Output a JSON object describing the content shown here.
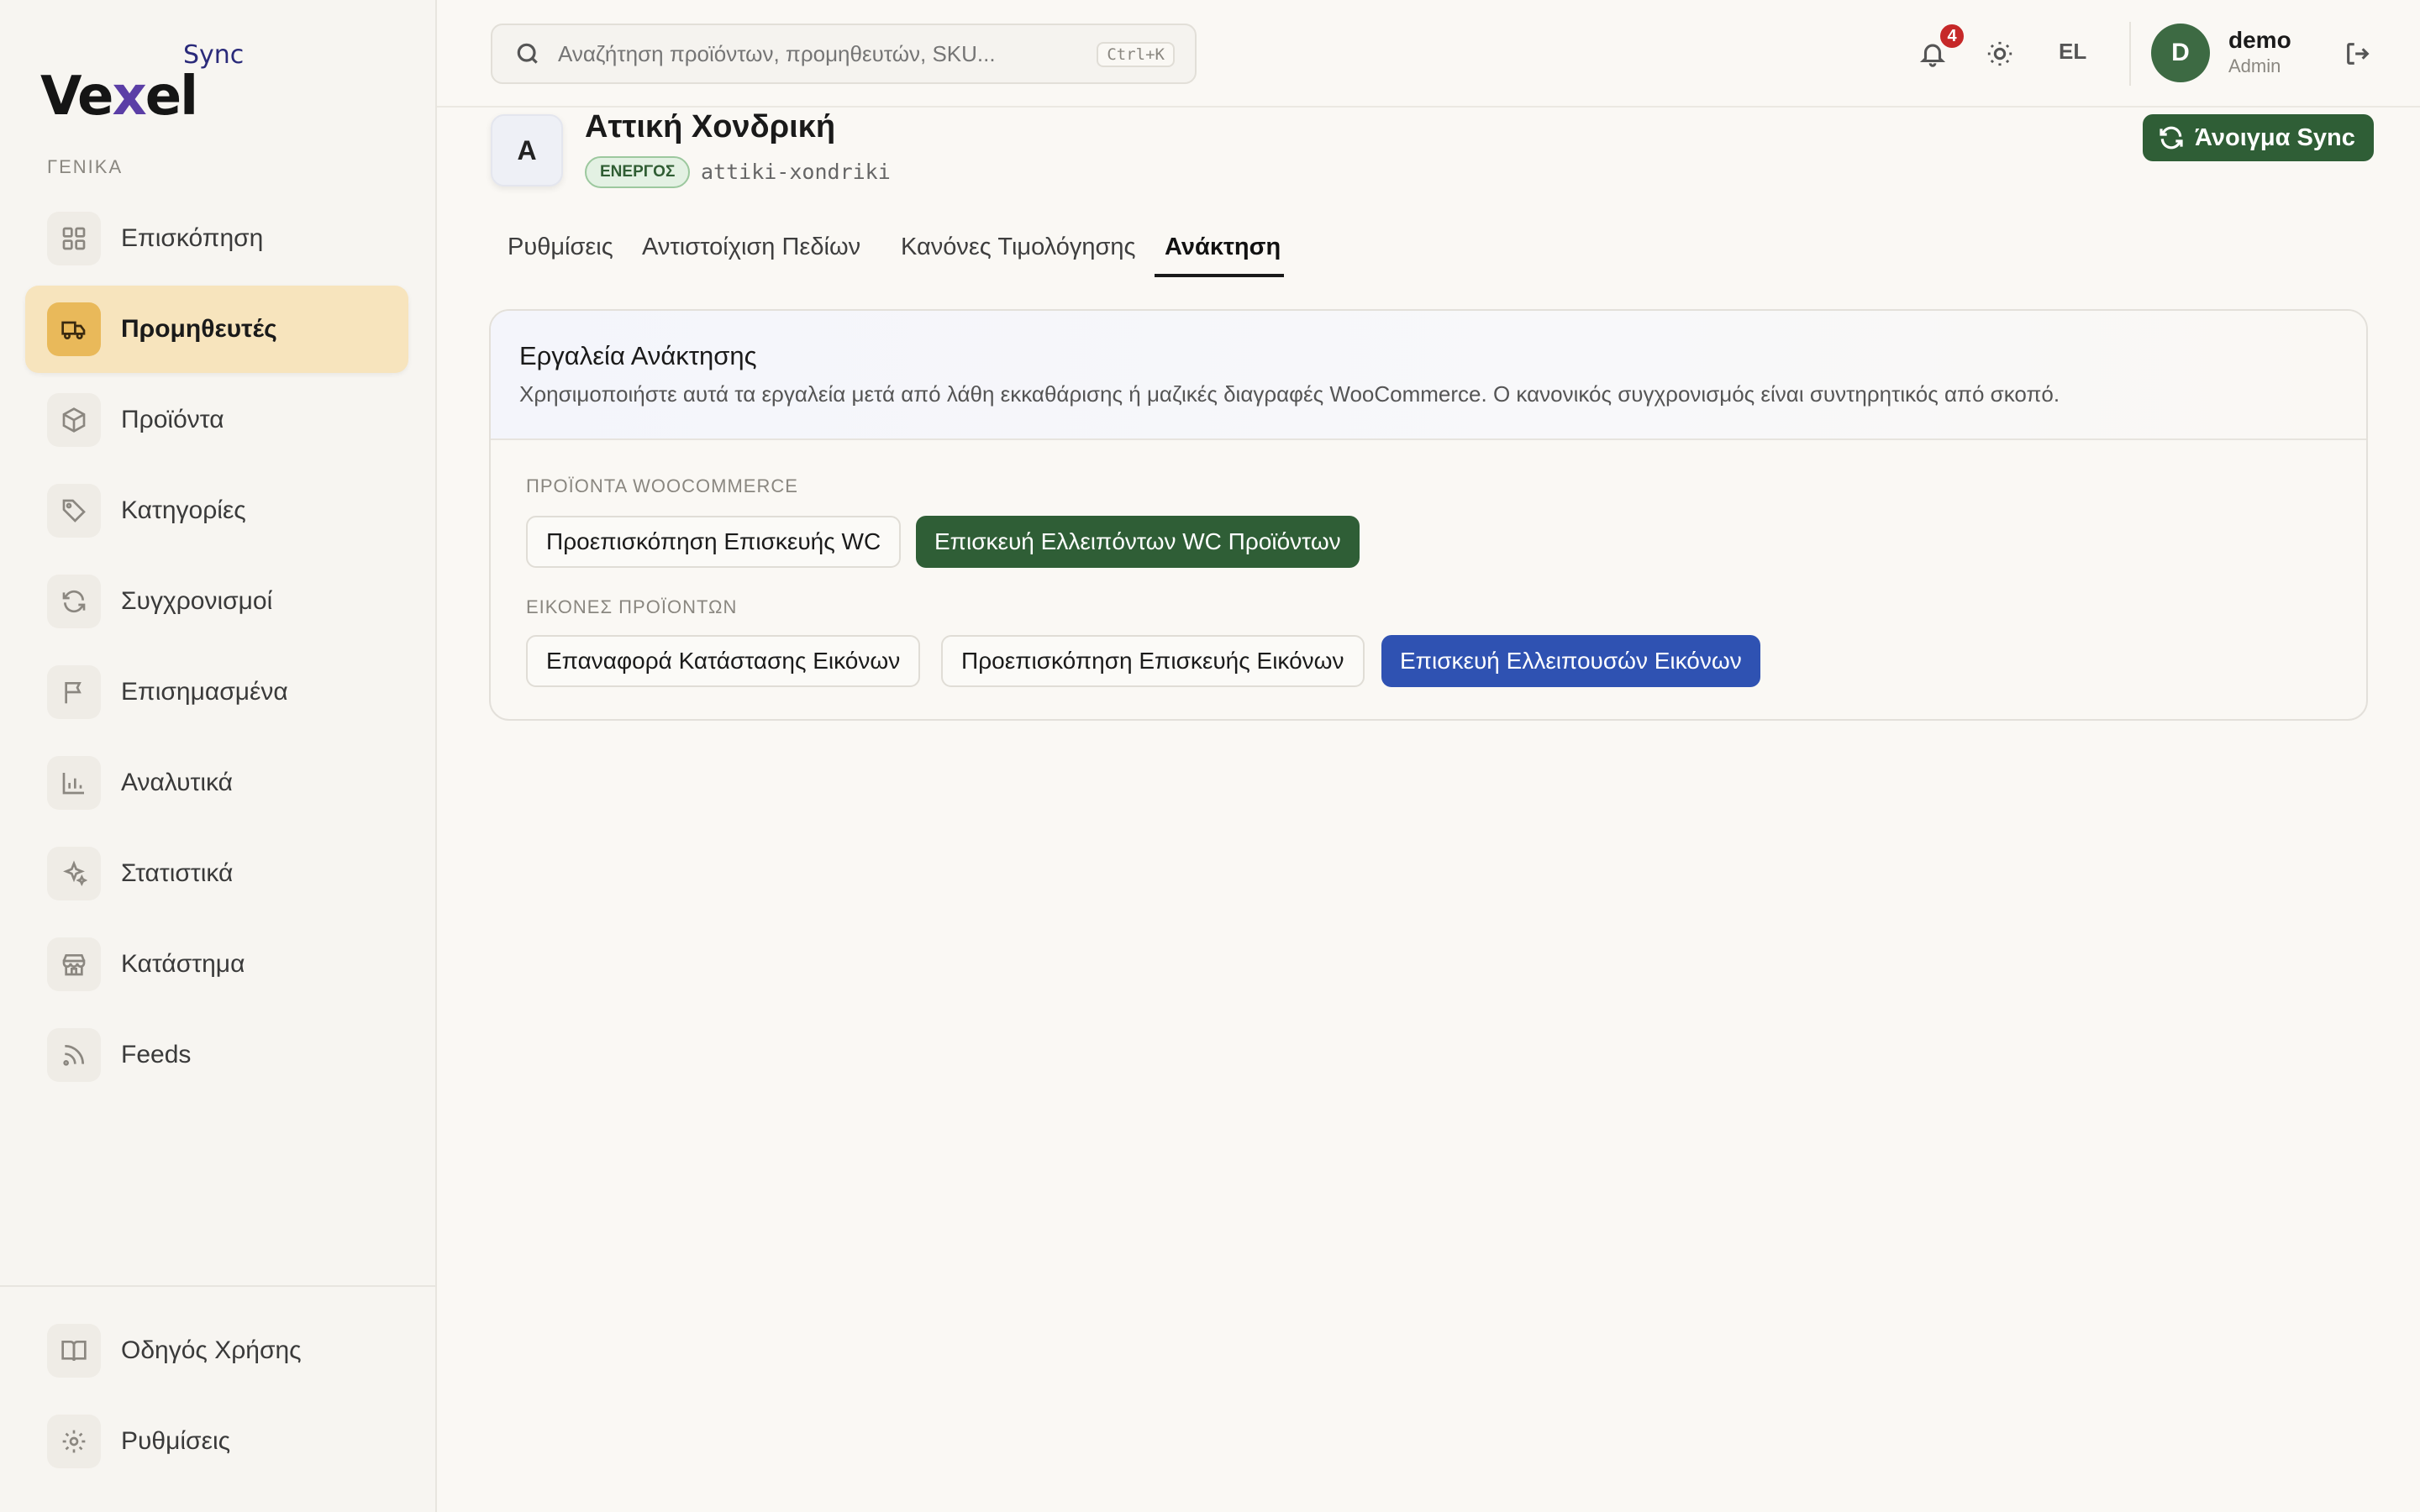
{
  "brand": {
    "name_prefix": "Ve",
    "name_x": "x",
    "name_suffix": "el",
    "sub": "Sync"
  },
  "sidebar": {
    "section_label": "ΓΕΝΙΚΑ",
    "items": [
      {
        "label": "Επισκόπηση",
        "icon": "grid-icon"
      },
      {
        "label": "Προμηθευτές",
        "icon": "truck-icon",
        "active": true
      },
      {
        "label": "Προϊόντα",
        "icon": "box-icon"
      },
      {
        "label": "Κατηγορίες",
        "icon": "tag-icon"
      },
      {
        "label": "Συγχρονισμοί",
        "icon": "refresh-icon"
      },
      {
        "label": "Επισημασμένα",
        "icon": "flag-icon"
      },
      {
        "label": "Αναλυτικά",
        "icon": "bar-chart-icon"
      },
      {
        "label": "Στατιστικά",
        "icon": "sparkles-icon"
      },
      {
        "label": "Κατάστημα",
        "icon": "store-icon"
      },
      {
        "label": "Feeds",
        "icon": "rss-icon"
      }
    ],
    "bottom_items": [
      {
        "label": "Οδηγός Χρήσης",
        "icon": "book-icon"
      },
      {
        "label": "Ρυθμίσεις",
        "icon": "gear-icon"
      }
    ]
  },
  "header": {
    "search_placeholder": "Αναζήτηση προϊόντων, προμηθευτών, SKU...",
    "search_shortcut": "Ctrl+K",
    "notifications_count": "4",
    "language": "EL",
    "user": {
      "initial": "D",
      "name": "demo",
      "role": "Admin"
    }
  },
  "supplier": {
    "initial": "A",
    "name": "Αττική Χονδρική",
    "status": "ΕΝΕΡΓΟΣ",
    "slug": "attiki-xondriki",
    "open_sync_label": "Άνοιγμα Sync"
  },
  "tabs": [
    {
      "label": "Ρυθμίσεις"
    },
    {
      "label": "Αντιστοίχιση Πεδίων"
    },
    {
      "label": "Κανόνες Τιμολόγησης"
    },
    {
      "label": "Ανάκτηση",
      "active": true
    }
  ],
  "recovery": {
    "title": "Εργαλεία Ανάκτησης",
    "description": "Χρησιμοποιήστε αυτά τα εργαλεία μετά από λάθη εκκαθάρισης ή μαζικές διαγραφές WooCommerce. Ο κανονικός συγχρονισμός είναι συντηρητικός από σκοπό.",
    "wc_group_label": "ΠΡΟΪΟΝΤΑ WOOCOMMERCE",
    "wc_preview_label": "Προεπισκόπηση Επισκευής WC",
    "wc_repair_label": "Επισκευή Ελλειπόντων WC Προϊόντων",
    "images_group_label": "ΕΙΚΟΝΕΣ ΠΡΟΪΟΝΤΩΝ",
    "images_reset_label": "Επαναφορά Κατάστασης Εικόνων",
    "images_preview_label": "Προεπισκόπηση Επισκευής Εικόνων",
    "images_repair_label": "Επισκευή Ελλειπουσών Εικόνων"
  },
  "colors": {
    "accent_green": "#2f5e36",
    "accent_blue": "#2f52b2",
    "active_nav": "#f7e4bd",
    "badge_red": "#c62828"
  }
}
